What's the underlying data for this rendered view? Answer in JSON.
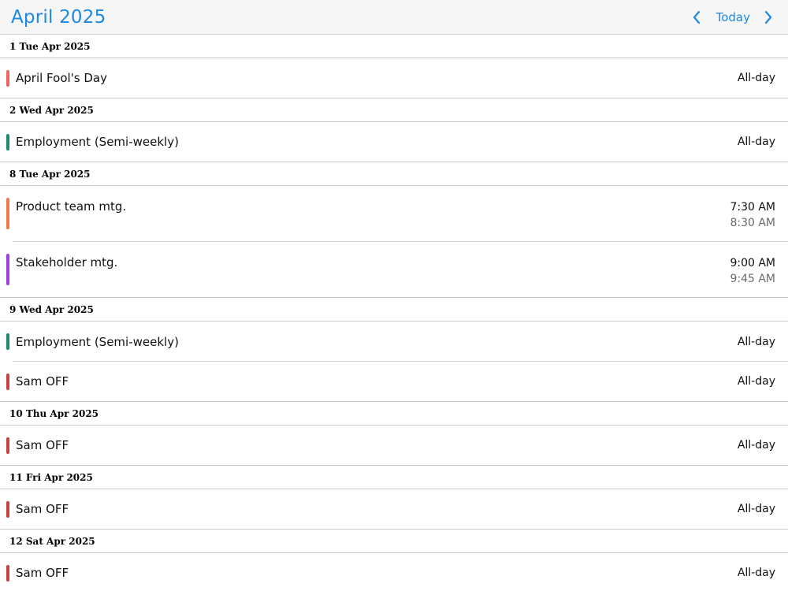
{
  "header": {
    "month_title": "April 2025",
    "today_label": "Today",
    "prev_icon": "chevron-left-icon",
    "next_icon": "chevron-right-icon",
    "accent_color": "#1e88e5"
  },
  "days": [
    {
      "label": "1 Tue Apr 2025",
      "events": [
        {
          "title": "April Fool's Day",
          "start": "All-day",
          "end": "",
          "color": "#ef6461"
        }
      ]
    },
    {
      "label": "2 Wed Apr 2025",
      "events": [
        {
          "title": "Employment (Semi-weekly)",
          "start": "All-day",
          "end": "",
          "color": "#1f8a72"
        }
      ]
    },
    {
      "label": "8 Tue Apr 2025",
      "events": [
        {
          "title": "Product team mtg.",
          "start": "7:30 AM",
          "end": "8:30 AM",
          "color": "#f0784a"
        },
        {
          "title": "Stakeholder mtg.",
          "start": "9:00 AM",
          "end": "9:45 AM",
          "color": "#9b3fe0"
        }
      ]
    },
    {
      "label": "9 Wed Apr 2025",
      "events": [
        {
          "title": "Employment (Semi-weekly)",
          "start": "All-day",
          "end": "",
          "color": "#1f8a72"
        },
        {
          "title": "Sam OFF",
          "start": "All-day",
          "end": "",
          "color": "#c8413f"
        }
      ]
    },
    {
      "label": "10 Thu Apr 2025",
      "events": [
        {
          "title": "Sam OFF",
          "start": "All-day",
          "end": "",
          "color": "#c8413f"
        }
      ]
    },
    {
      "label": "11 Fri Apr 2025",
      "events": [
        {
          "title": "Sam OFF",
          "start": "All-day",
          "end": "",
          "color": "#c8413f"
        }
      ]
    },
    {
      "label": "12 Sat Apr 2025",
      "events": [
        {
          "title": "Sam OFF",
          "start": "All-day",
          "end": "",
          "color": "#c8413f"
        }
      ]
    }
  ]
}
